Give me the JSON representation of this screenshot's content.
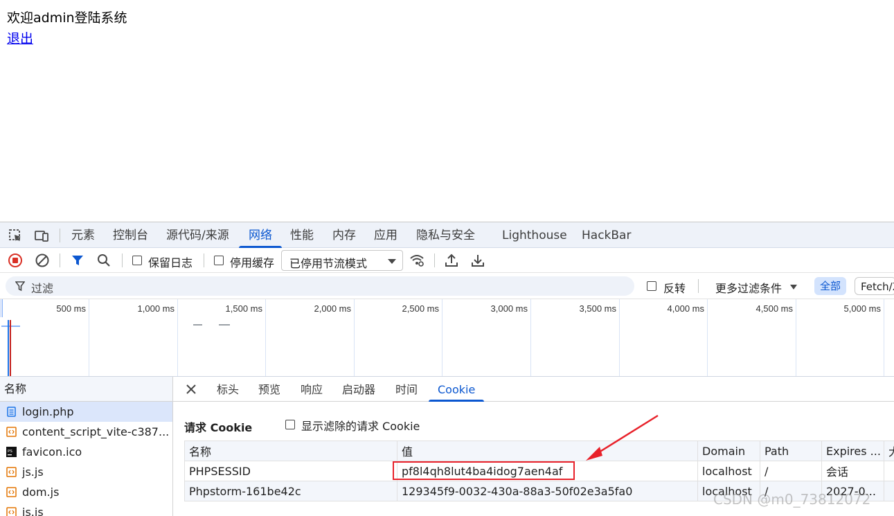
{
  "page": {
    "welcome": "欢迎admin登陆系统",
    "logout": "退出"
  },
  "devtools": {
    "tabs": [
      "元素",
      "控制台",
      "源代码/来源",
      "网络",
      "性能",
      "内存",
      "应用",
      "隐私与安全",
      "Lighthouse",
      "HackBar"
    ],
    "active_tab": "网络",
    "toolbar": {
      "preserve_log": "保留日志",
      "disable_cache": "停用缓存",
      "throttle": "已停用节流模式"
    },
    "filter": {
      "placeholder": "过滤",
      "invert": "反转",
      "more_filters": "更多过滤条件",
      "all": "全部",
      "fetch": "Fetch/X"
    },
    "timeline": {
      "ticks": [
        "500 ms",
        "1,000 ms",
        "1,500 ms",
        "2,000 ms",
        "2,500 ms",
        "3,000 ms",
        "3,500 ms",
        "4,000 ms",
        "4,500 ms",
        "5,000 ms"
      ]
    },
    "requests": {
      "header": "名称",
      "items": [
        {
          "name": "login.php",
          "icon": "document-icon",
          "selected": true
        },
        {
          "name": "content_script_vite-c387...",
          "icon": "script-icon"
        },
        {
          "name": "favicon.ico",
          "icon": "phpstorm-icon"
        },
        {
          "name": "js.js",
          "icon": "script-icon"
        },
        {
          "name": "dom.js",
          "icon": "script-icon"
        },
        {
          "name": "is.is",
          "icon": "script-icon"
        }
      ]
    },
    "detail": {
      "tabs": [
        "标头",
        "预览",
        "响应",
        "启动器",
        "时间",
        "Cookie"
      ],
      "active_tab": "Cookie",
      "section_title": "请求 Cookie",
      "show_filtered": "显示滤除的请求 Cookie",
      "columns": [
        "名称",
        "值",
        "Domain",
        "Path",
        "Expires ...",
        "大"
      ],
      "rows": [
        [
          "PHPSESSID",
          "pf8l4qh8lut4ba4idog7aen4af",
          "localhost",
          "/",
          "会话",
          ""
        ],
        [
          "Phpstorm-161be42c",
          "129345f9-0032-430a-88a3-50f02e3a5fa0",
          "localhost",
          "/",
          "2027-0...",
          ""
        ]
      ]
    }
  },
  "watermark": "CSDN @m0_73812072",
  "colors": {
    "accent": "#0b57d0",
    "annotation_red": "#e8212a",
    "record_red": "#d93025"
  }
}
